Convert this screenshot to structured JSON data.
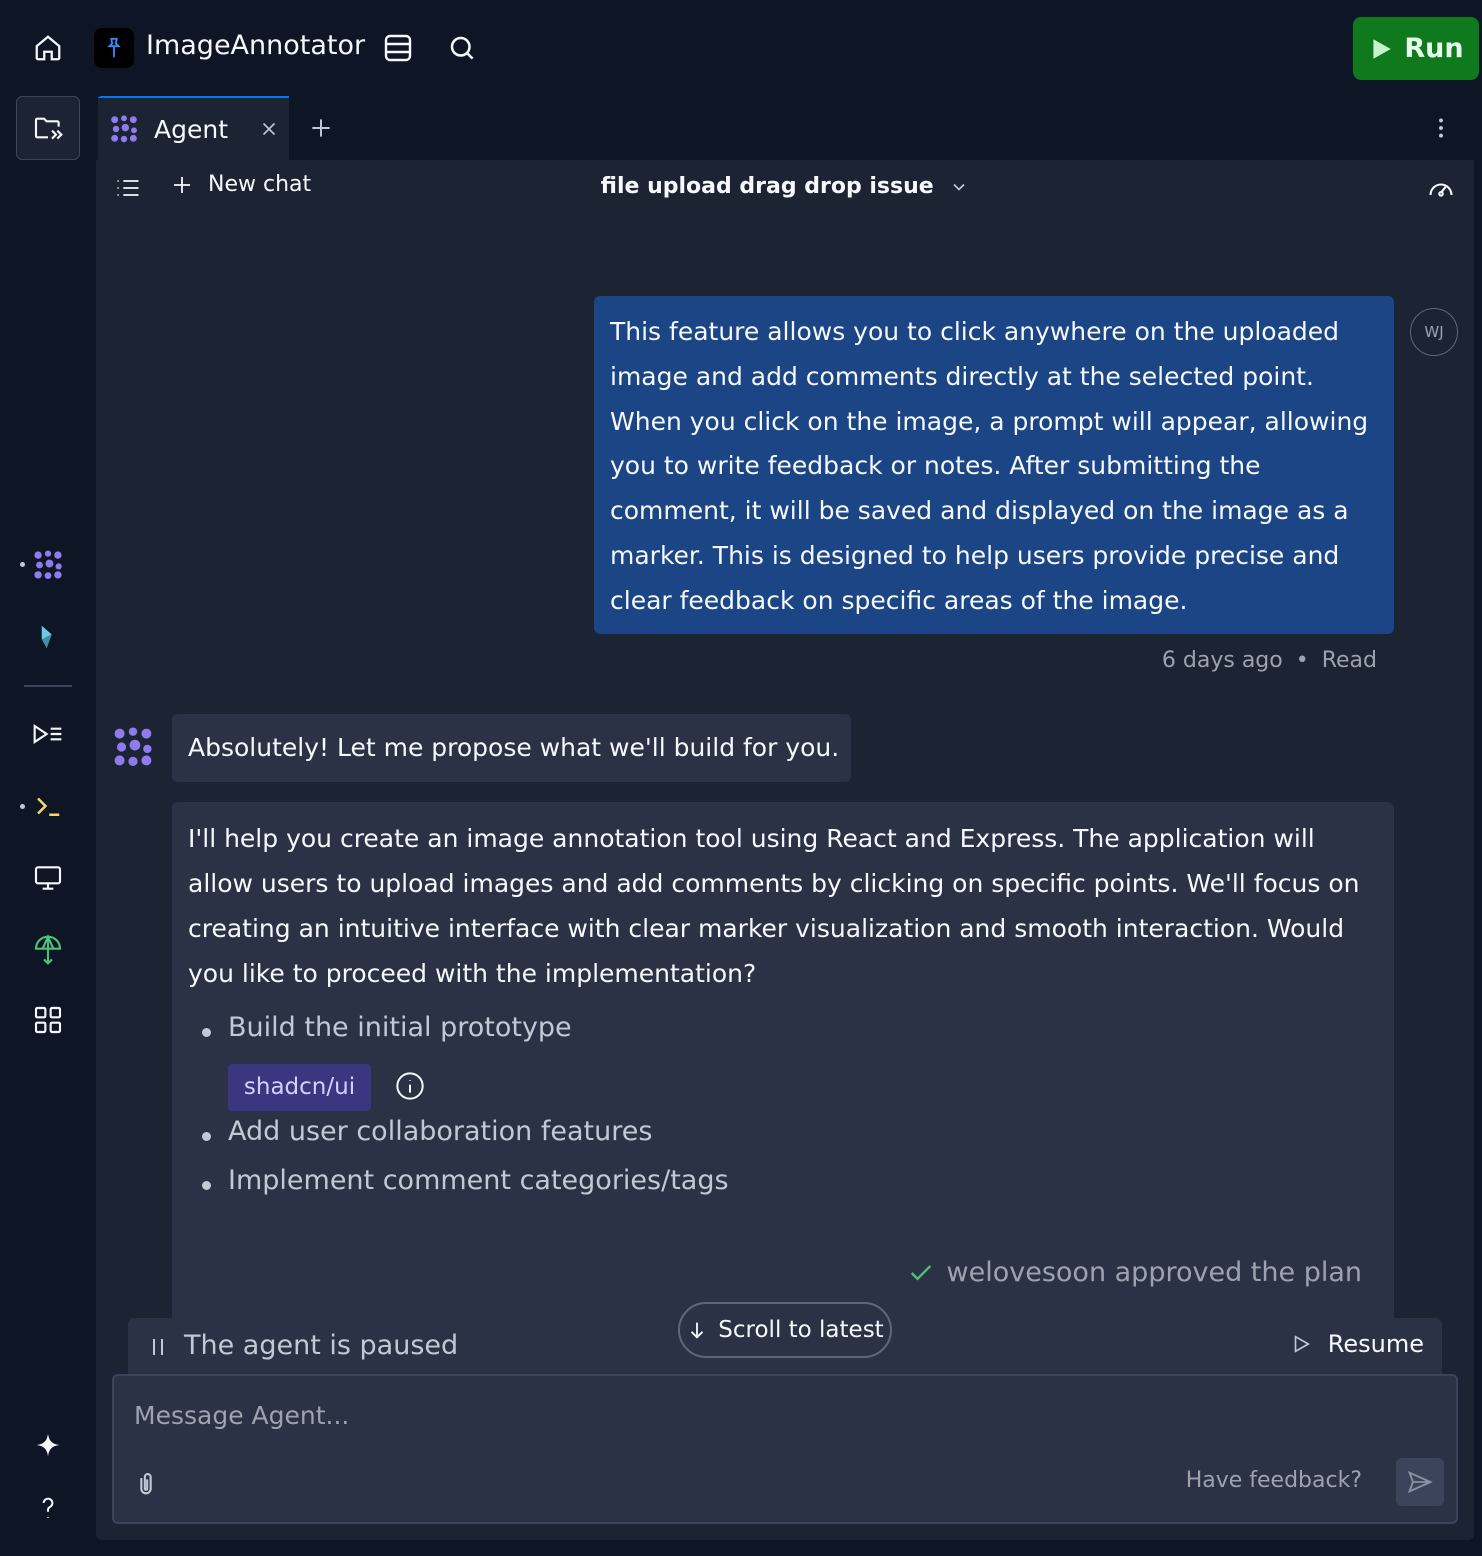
{
  "app": {
    "name": "ImageAnnotator",
    "run_label": "Run"
  },
  "tabs": [
    {
      "label": "Agent",
      "active": true
    }
  ],
  "chat": {
    "new_chat_label": "New chat",
    "title": "file upload drag drop issue"
  },
  "messages": {
    "user": {
      "avatar_initials": "WJ",
      "text": "This feature allows you to click anywhere on the uploaded image and add comments directly at the selected point. When you click on the image, a prompt will appear, allowing you to write feedback or notes. After submitting the comment, it will be saved and displayed on the image as a marker. This is designed to help users provide precise and clear feedback on specific areas of the image.",
      "time": "6 days ago",
      "status": "Read"
    },
    "agent_intro": "Absolutely! Let me propose what we'll build for you.",
    "agent_plan": {
      "text": "I'll help you create an image annotation tool using React and Express. The application will allow users to upload images and add comments by clicking on specific points. We'll focus on creating an intuitive interface with clear marker visualization and smooth interaction. Would you like to proceed with the implementation?",
      "items": [
        "Build the initial prototype",
        "Add user collaboration features",
        "Implement comment categories/tags"
      ],
      "tag": "shadcn/ui",
      "approval": "welovesoon approved the plan"
    }
  },
  "status_bar": {
    "paused_text": "The agent is paused",
    "resume_label": "Resume",
    "scroll_label": "Scroll to latest"
  },
  "composer": {
    "placeholder": "Message Agent...",
    "feedback_label": "Have feedback?"
  },
  "colors": {
    "background": "#0e1525",
    "panel": "#1c2333",
    "user_bubble": "#1c4585",
    "agent_bubble": "#2b3245",
    "run_button": "#0e7a1d",
    "accent_purple": "#8f7bf0",
    "tag_bg": "#3b3680"
  }
}
